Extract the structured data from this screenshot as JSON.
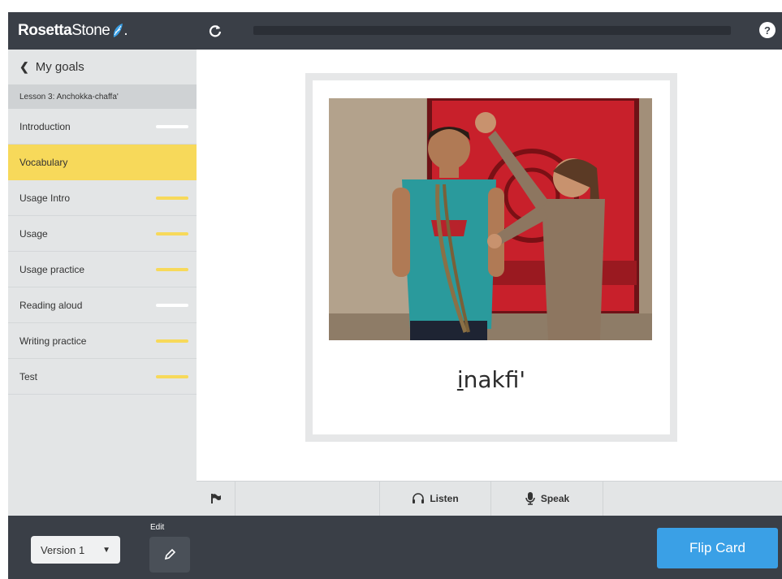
{
  "brand": {
    "name_bold": "Rosetta",
    "name_light": "Stone",
    "dot": "."
  },
  "sidebar": {
    "back_label": "My goals",
    "lesson_title": "Lesson 3: Anchokka-chaffa'",
    "items": [
      {
        "label": "Introduction",
        "progress": "white"
      },
      {
        "label": "Vocabulary",
        "progress": "active"
      },
      {
        "label": "Usage Intro",
        "progress": "yellow"
      },
      {
        "label": "Usage",
        "progress": "yellow"
      },
      {
        "label": "Usage practice",
        "progress": "yellow"
      },
      {
        "label": "Reading aloud",
        "progress": "white"
      },
      {
        "label": "Writing practice",
        "progress": "yellow"
      },
      {
        "label": "Test",
        "progress": "yellow"
      }
    ]
  },
  "topbar": {
    "help_symbol": "?"
  },
  "card": {
    "word_underlined": "i",
    "word_rest": "nakfi'"
  },
  "actions": {
    "listen_label": "Listen",
    "speak_label": "Speak"
  },
  "footer": {
    "version_value": "Version 1",
    "edit_label": "Edit",
    "flip_label": "Flip Card"
  },
  "colors": {
    "accent_yellow": "#f7d95a",
    "dark": "#3a3f47",
    "flip_blue": "#3aa0e6"
  }
}
